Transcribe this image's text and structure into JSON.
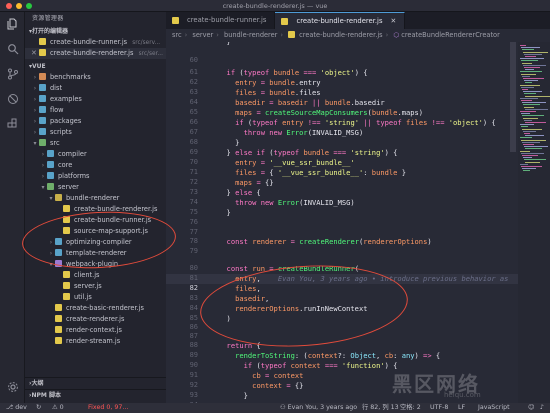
{
  "window": {
    "title": "create-bundle-renderer.js — vue"
  },
  "activity_icons": [
    "files-icon",
    "search-icon",
    "source-control-icon",
    "debug-icon",
    "extensions-icon",
    "settings-gear-icon"
  ],
  "sidebar": {
    "header": "资源管理器",
    "open_editors_title": "打开的编辑器",
    "open_editors": [
      {
        "name": "create-bundle-runner.js",
        "path": "src/serv..."
      },
      {
        "name": "create-bundle-renderer.js",
        "path": "src/ser..."
      }
    ],
    "project_title": "VUE",
    "tree": [
      {
        "label": "benchmarks",
        "kind": "folder",
        "depth": 0,
        "open": false,
        "color": "c1"
      },
      {
        "label": "dist",
        "kind": "folder",
        "depth": 0,
        "open": false,
        "color": "c2"
      },
      {
        "label": "examples",
        "kind": "folder",
        "depth": 0,
        "open": false,
        "color": "c2"
      },
      {
        "label": "flow",
        "kind": "folder",
        "depth": 0,
        "open": false,
        "color": "c2"
      },
      {
        "label": "packages",
        "kind": "folder",
        "depth": 0,
        "open": false,
        "color": "c2"
      },
      {
        "label": "scripts",
        "kind": "folder",
        "depth": 0,
        "open": false,
        "color": "c2"
      },
      {
        "label": "src",
        "kind": "folder",
        "depth": 0,
        "open": true,
        "color": "c4"
      },
      {
        "label": "compiler",
        "kind": "folder",
        "depth": 1,
        "open": false,
        "color": "c2"
      },
      {
        "label": "core",
        "kind": "folder",
        "depth": 1,
        "open": false,
        "color": "c2"
      },
      {
        "label": "platforms",
        "kind": "folder",
        "depth": 1,
        "open": false,
        "color": "c2"
      },
      {
        "label": "server",
        "kind": "folder",
        "depth": 1,
        "open": true,
        "color": "c4"
      },
      {
        "label": "bundle-renderer",
        "kind": "folder",
        "depth": 2,
        "open": true,
        "color": "c3"
      },
      {
        "label": "create-bundle-renderer.js",
        "kind": "js",
        "depth": 3
      },
      {
        "label": "create-bundle-runner.js",
        "kind": "js",
        "depth": 3
      },
      {
        "label": "source-map-support.js",
        "kind": "js",
        "depth": 3
      },
      {
        "label": "optimizing-compiler",
        "kind": "folder",
        "depth": 2,
        "open": false,
        "color": "c2"
      },
      {
        "label": "template-renderer",
        "kind": "folder",
        "depth": 2,
        "open": false,
        "color": "c2"
      },
      {
        "label": "webpack-plugin",
        "kind": "folder",
        "depth": 2,
        "open": true,
        "color": "c5"
      },
      {
        "label": "client.js",
        "kind": "js",
        "depth": 3
      },
      {
        "label": "server.js",
        "kind": "js",
        "depth": 3
      },
      {
        "label": "util.js",
        "kind": "js",
        "depth": 3
      },
      {
        "label": "create-basic-renderer.js",
        "kind": "js",
        "depth": 2
      },
      {
        "label": "create-renderer.js",
        "kind": "js",
        "depth": 2
      },
      {
        "label": "render-context.js",
        "kind": "js",
        "depth": 2
      },
      {
        "label": "render-stream.js",
        "kind": "js",
        "depth": 2
      }
    ],
    "outline_title": "大纲",
    "npm_title": "NPM 脚本"
  },
  "tabs": [
    {
      "label": "create-bundle-runner.js",
      "active": false
    },
    {
      "label": "create-bundle-renderer.js",
      "active": true
    }
  ],
  "breadcrumbs": [
    "src",
    "server",
    "bundle-renderer",
    "create-bundle-renderer.js",
    "createBundleRendererCreator"
  ],
  "editor": {
    "line_numbers": [
      "",
      "60",
      "61",
      "62",
      "63",
      "64",
      "65",
      "66",
      "67",
      "68",
      "69",
      "70",
      "71",
      "72",
      "73",
      "74",
      "75",
      "76",
      "77",
      "78",
      "79",
      "80",
      "81",
      "82",
      "83",
      "84",
      "85",
      "86",
      "87",
      "88",
      "89",
      "90",
      "91",
      "92",
      "93",
      "94"
    ],
    "blame": "Evan You, 3 years ago • introduce previous behavior as"
  },
  "status": {
    "branch": "dev",
    "errors": "Fixed 0, 97...",
    "blame": "Evan You, 3 years ago",
    "position": "行 82, 列 13",
    "spaces": "空格: 2",
    "encoding": "UTF-8",
    "eol": "LF",
    "language": "JavaScript"
  },
  "watermark": {
    "main": "黑区网络",
    "sub": "heiqu.com"
  },
  "colors": {
    "accent": "#4e9bd6",
    "annotation": "#e14b3b",
    "editor_bg": "#282a36"
  }
}
